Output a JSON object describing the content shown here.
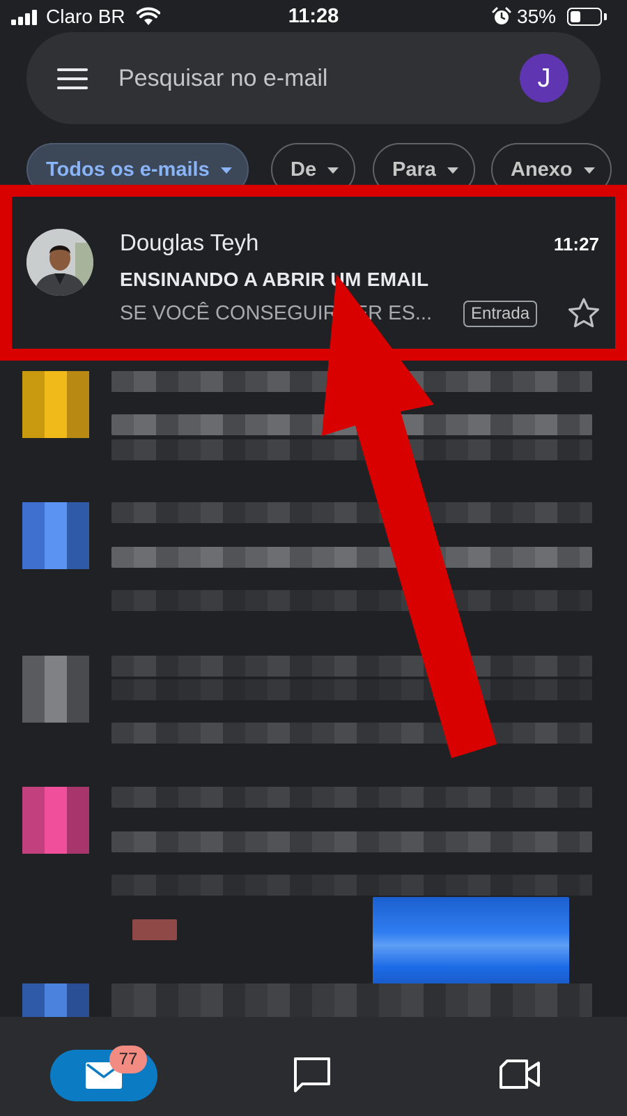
{
  "status_bar": {
    "carrier": "Claro BR",
    "time": "11:28",
    "battery_percent": "35%",
    "battery_level": 0.35
  },
  "search": {
    "placeholder": "Pesquisar no e-mail",
    "account_initial": "J",
    "account_color": "#5f35b2"
  },
  "filters": [
    {
      "label": "Todos os e-mails",
      "active": true
    },
    {
      "label": "De",
      "active": false
    },
    {
      "label": "Para",
      "active": false
    },
    {
      "label": "Anexo",
      "active": false
    }
  ],
  "email": {
    "sender": "Douglas Teyh",
    "time": "11:27",
    "subject": "ENSINANDO A ABRIR UM EMAIL",
    "snippet": "SE VOCÊ CONSEGUIR LER ES...",
    "label": "Entrada",
    "starred": false
  },
  "bottom_nav": {
    "mail_badge": "77",
    "tabs": [
      "mail-icon",
      "chat-icon",
      "meet-icon"
    ]
  },
  "colors": {
    "background": "#202124",
    "highlight": "#d90000",
    "accent": "#8ab4f8"
  }
}
